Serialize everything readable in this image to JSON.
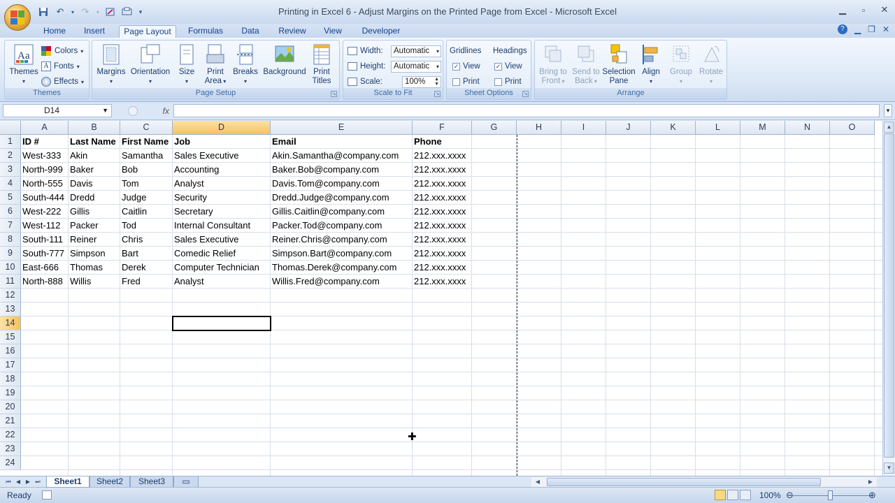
{
  "window": {
    "title": "Printing in Excel 6 - Adjust Margins on the Printed Page from Excel - Microsoft Excel"
  },
  "tabs": [
    "Home",
    "Insert",
    "Page Layout",
    "Formulas",
    "Data",
    "Review",
    "View",
    "Developer"
  ],
  "active_tab": "Page Layout",
  "ribbon": {
    "themes": {
      "label": "Themes",
      "button": "Themes",
      "colors": "Colors",
      "fonts": "Fonts",
      "effects": "Effects"
    },
    "page_setup": {
      "label": "Page Setup",
      "margins": "Margins",
      "orientation": "Orientation",
      "size": "Size",
      "print_area_1": "Print",
      "print_area_2": "Area",
      "breaks": "Breaks",
      "background": "Background",
      "print_titles_1": "Print",
      "print_titles_2": "Titles"
    },
    "scale_to_fit": {
      "label": "Scale to Fit",
      "width_label": "Width:",
      "width_value": "Automatic",
      "height_label": "Height:",
      "height_value": "Automatic",
      "scale_label": "Scale:",
      "scale_value": "100%"
    },
    "sheet_options": {
      "label": "Sheet Options",
      "gridlines": "Gridlines",
      "headings": "Headings",
      "view": "View",
      "print": "Print"
    },
    "arrange": {
      "label": "Arrange",
      "bring_to_front_1": "Bring to",
      "bring_to_front_2": "Front",
      "send_to_back_1": "Send to",
      "send_to_back_2": "Back",
      "selection_pane_1": "Selection",
      "selection_pane_2": "Pane",
      "align": "Align",
      "group": "Group",
      "rotate": "Rotate"
    }
  },
  "formula_bar": {
    "name_box": "D14",
    "fx": "fx",
    "formula": ""
  },
  "columns": [
    "A",
    "B",
    "C",
    "D",
    "E",
    "F",
    "G",
    "H",
    "I",
    "J",
    "K",
    "L",
    "M",
    "N",
    "O"
  ],
  "selected_column": "D",
  "row_numbers": [
    "1",
    "2",
    "3",
    "4",
    "5",
    "6",
    "7",
    "8",
    "9",
    "10",
    "11",
    "12",
    "13",
    "14",
    "15",
    "16",
    "17",
    "18",
    "19",
    "20",
    "21",
    "22",
    "23",
    "24"
  ],
  "selected_row": "14",
  "headers": [
    "ID #",
    "Last Name",
    "First Name",
    "Job",
    "Email",
    "Phone"
  ],
  "rows": [
    [
      "West-333",
      "Akin",
      "Samantha",
      "Sales Executive",
      "Akin.Samantha@company.com",
      "212.xxx.xxxx"
    ],
    [
      "North-999",
      "Baker",
      "Bob",
      "Accounting",
      "Baker.Bob@company.com",
      "212.xxx.xxxx"
    ],
    [
      "North-555",
      "Davis",
      "Tom",
      "Analyst",
      "Davis.Tom@company.com",
      "212.xxx.xxxx"
    ],
    [
      "South-444",
      "Dredd",
      "Judge",
      "Security",
      "Dredd.Judge@company.com",
      "212.xxx.xxxx"
    ],
    [
      "West-222",
      "Gillis",
      "Caitlin",
      "Secretary",
      "Gillis.Caitlin@company.com",
      "212.xxx.xxxx"
    ],
    [
      "West-112",
      "Packer",
      "Tod",
      "Internal Consultant",
      "Packer.Tod@company.com",
      "212.xxx.xxxx"
    ],
    [
      "South-111",
      "Reiner",
      "Chris",
      "Sales Executive",
      "Reiner.Chris@company.com",
      "212.xxx.xxxx"
    ],
    [
      "South-777",
      "Simpson",
      "Bart",
      "Comedic Relief",
      "Simpson.Bart@company.com",
      "212.xxx.xxxx"
    ],
    [
      "East-666",
      "Thomas",
      "Derek",
      "Computer Technician",
      "Thomas.Derek@company.com",
      "212.xxx.xxxx"
    ],
    [
      "North-888",
      "Willis",
      "Fred",
      "Analyst",
      "Willis.Fred@company.com",
      "212.xxx.xxxx"
    ]
  ],
  "sheets": [
    "Sheet1",
    "Sheet2",
    "Sheet3"
  ],
  "active_sheet": "Sheet1",
  "status": {
    "ready": "Ready",
    "zoom": "100%"
  },
  "colors": {
    "selected_header": "#f6c25b",
    "ribbon_text": "#15428b"
  }
}
